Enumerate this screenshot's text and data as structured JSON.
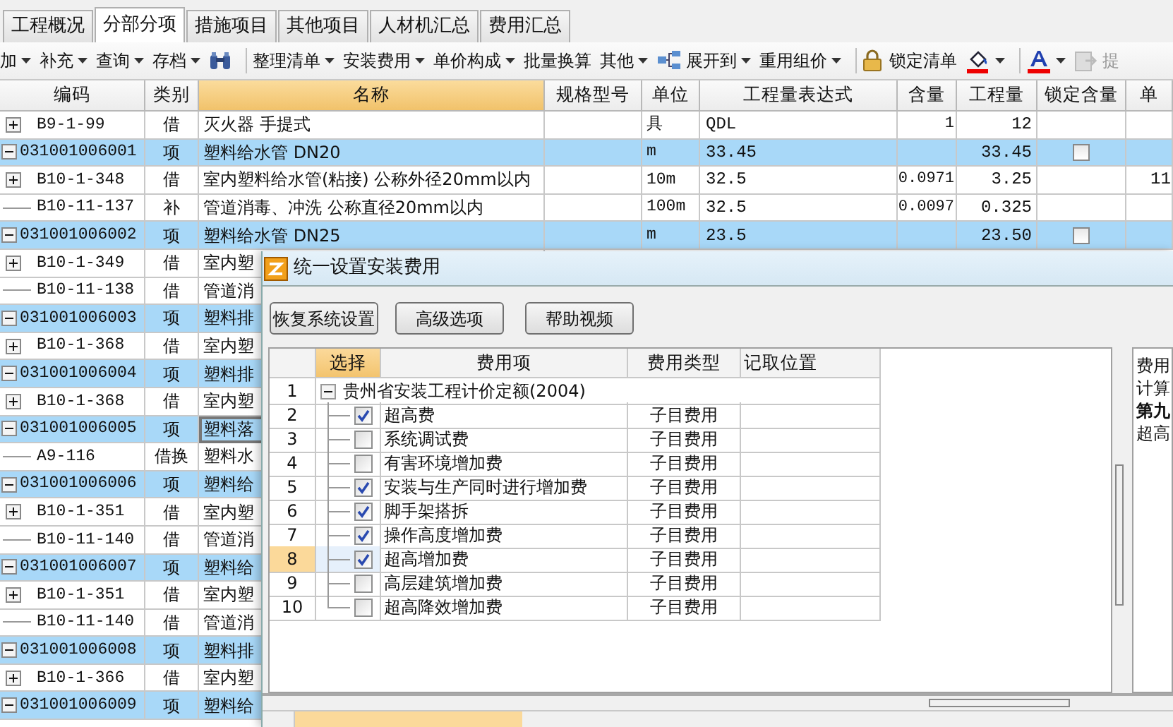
{
  "tabs": [
    {
      "label": "工程概况",
      "selected": false
    },
    {
      "label": "分部分项",
      "selected": true
    },
    {
      "label": "措施项目",
      "selected": false
    },
    {
      "label": "其他项目",
      "selected": false
    },
    {
      "label": "人材机汇总",
      "selected": false
    },
    {
      "label": "费用汇总",
      "selected": false
    }
  ],
  "toolbar": [
    {
      "kind": "menu",
      "label": "加",
      "dropdown": true
    },
    {
      "kind": "menu",
      "label": "补充",
      "dropdown": true
    },
    {
      "kind": "menu",
      "label": "查询",
      "dropdown": true
    },
    {
      "kind": "menu",
      "label": "存档",
      "dropdown": true
    },
    {
      "kind": "find"
    },
    {
      "kind": "separator"
    },
    {
      "kind": "menu",
      "label": "整理清单",
      "dropdown": true
    },
    {
      "kind": "menu",
      "label": "安装费用",
      "dropdown": true
    },
    {
      "kind": "menu",
      "label": "单价构成",
      "dropdown": true
    },
    {
      "kind": "menu",
      "label": "批量换算",
      "dropdown": false
    },
    {
      "kind": "menu",
      "label": "其他",
      "dropdown": true
    },
    {
      "kind": "expand",
      "label": "展开到",
      "dropdown": true
    },
    {
      "kind": "menu",
      "label": "重用组价",
      "dropdown": true
    },
    {
      "kind": "separator"
    },
    {
      "kind": "lock",
      "label": "锁定清单",
      "dropdown": false
    },
    {
      "kind": "fill",
      "dropdown": true
    },
    {
      "kind": "separator"
    },
    {
      "kind": "font",
      "dropdown": true
    },
    {
      "kind": "extract",
      "label": "提",
      "disabled": true
    }
  ],
  "table": {
    "columns": [
      {
        "label": "编码",
        "selected": false
      },
      {
        "label": "类别",
        "selected": false
      },
      {
        "label": "名称",
        "selected": true
      },
      {
        "label": "规格型号",
        "selected": false
      },
      {
        "label": "单位",
        "selected": false
      },
      {
        "label": "工程量表达式",
        "selected": false
      },
      {
        "label": "含量",
        "selected": false
      },
      {
        "label": "工程量",
        "selected": false
      },
      {
        "label": "锁定含量",
        "selected": false
      },
      {
        "label": "单",
        "selected": false
      }
    ],
    "rows": [
      {
        "kind": "quota",
        "expander": true,
        "expanded": false,
        "code": "B9-1-99",
        "type": "借",
        "name": "灭火器 手提式",
        "unit": "具",
        "expression": "QDL",
        "content": "1",
        "quantity": "12",
        "cell_selected": false
      },
      {
        "kind": "bill",
        "expander": true,
        "expanded": true,
        "code": "031001006001",
        "type": "项",
        "name": "塑料给水管 DN20",
        "unit": "m",
        "expression": "33.45",
        "quantity": "33.45",
        "locked": false,
        "cell_selected": false
      },
      {
        "kind": "quota",
        "expander": true,
        "expanded": false,
        "code": "B10-1-348",
        "type": "借",
        "name": "室内塑料给水管(粘接) 公称外径20mm以内",
        "unit": "10m",
        "expression": "32.5",
        "content": "0.0971",
        "quantity": "3.25",
        "price": "11",
        "cell_selected": false
      },
      {
        "kind": "quota",
        "expander": false,
        "code": "B10-11-137",
        "type": "补",
        "name": "管道消毒、冲洗 公称直径20mm以内",
        "unit": "100m",
        "expression": "32.5",
        "content": "0.0097",
        "quantity": "0.325",
        "cell_selected": false
      },
      {
        "kind": "bill",
        "expander": true,
        "expanded": true,
        "code": "031001006002",
        "type": "项",
        "name": "塑料给水管 DN25",
        "unit": "m",
        "expression": "23.5",
        "quantity": "23.50",
        "locked": false,
        "cell_selected": false
      },
      {
        "kind": "quota",
        "expander": true,
        "expanded": false,
        "code": "B10-1-349",
        "type": "借",
        "name": "室内塑",
        "cell_selected": false
      },
      {
        "kind": "quota",
        "expander": false,
        "code": "B10-11-138",
        "type": "借",
        "name": "管道消",
        "cell_selected": false
      },
      {
        "kind": "bill",
        "expander": true,
        "expanded": true,
        "code": "031001006003",
        "type": "项",
        "name": "塑料排",
        "cell_selected": false
      },
      {
        "kind": "quota",
        "expander": true,
        "expanded": false,
        "code": "B10-1-368",
        "type": "借",
        "name": "室内塑",
        "cell_selected": false
      },
      {
        "kind": "bill",
        "expander": true,
        "expanded": true,
        "code": "031001006004",
        "type": "项",
        "name": "塑料排",
        "cell_selected": false
      },
      {
        "kind": "quota",
        "expander": true,
        "expanded": false,
        "code": "B10-1-368",
        "type": "借",
        "name": "室内塑",
        "cell_selected": false
      },
      {
        "kind": "bill",
        "expander": true,
        "expanded": true,
        "code": "031001006005",
        "type": "项",
        "name": "塑料落",
        "cell_selected": true
      },
      {
        "kind": "quota",
        "expander": false,
        "code": "A9-116",
        "type": "借换",
        "name": "塑料水",
        "cell_selected": false
      },
      {
        "kind": "bill",
        "expander": true,
        "expanded": true,
        "code": "031001006006",
        "type": "项",
        "name": "塑料给",
        "cell_selected": false
      },
      {
        "kind": "quota",
        "expander": true,
        "expanded": false,
        "code": "B10-1-351",
        "type": "借",
        "name": "室内塑",
        "cell_selected": false
      },
      {
        "kind": "quota",
        "expander": false,
        "code": "B10-11-140",
        "type": "借",
        "name": "管道消",
        "cell_selected": false
      },
      {
        "kind": "bill",
        "expander": true,
        "expanded": true,
        "code": "031001006007",
        "type": "项",
        "name": "塑料给",
        "cell_selected": false
      },
      {
        "kind": "quota",
        "expander": true,
        "expanded": false,
        "code": "B10-1-351",
        "type": "借",
        "name": "室内塑",
        "cell_selected": false
      },
      {
        "kind": "quota",
        "expander": false,
        "code": "B10-11-140",
        "type": "借",
        "name": "管道消",
        "cell_selected": false
      },
      {
        "kind": "bill",
        "expander": true,
        "expanded": true,
        "code": "031001006008",
        "type": "项",
        "name": "塑料排",
        "cell_selected": false
      },
      {
        "kind": "quota",
        "expander": true,
        "expanded": false,
        "code": "B10-1-366",
        "type": "借",
        "name": "室内塑",
        "cell_selected": false
      },
      {
        "kind": "bill",
        "expander": true,
        "expanded": true,
        "code": "031001006009",
        "type": "项",
        "name": "塑料给",
        "cell_selected": false
      }
    ]
  },
  "dialog": {
    "title": "统一设置安装费用",
    "buttons": [
      "恢复系统设置",
      "高级选项",
      "帮助视频"
    ],
    "grid": {
      "columns": [
        {
          "label": "选择",
          "selected": true
        },
        {
          "label": "费用项",
          "selected": false
        },
        {
          "label": "费用类型",
          "selected": false
        },
        {
          "label": "记取位置",
          "selected": false
        }
      ],
      "root": {
        "number": "1",
        "label": "贵州省安装工程计价定额(2004)",
        "expanded": true,
        "children": [
          {
            "number": "2",
            "label": "超高费",
            "checked": true,
            "type": "子目费用",
            "selected": false
          },
          {
            "number": "3",
            "label": "系统调试费",
            "checked": false,
            "type": "子目费用",
            "selected": false
          },
          {
            "number": "4",
            "label": "有害环境增加费",
            "checked": false,
            "type": "子目费用",
            "selected": false
          },
          {
            "number": "5",
            "label": "安装与生产同时进行增加费",
            "checked": true,
            "type": "子目费用",
            "selected": false
          },
          {
            "number": "6",
            "label": "脚手架搭拆",
            "checked": true,
            "type": "子目费用",
            "selected": false
          },
          {
            "number": "7",
            "label": "操作高度增加费",
            "checked": true,
            "type": "子目费用",
            "selected": false
          },
          {
            "number": "8",
            "label": "超高增加费",
            "checked": true,
            "type": "子目费用",
            "selected": true
          },
          {
            "number": "9",
            "label": "高层建筑增加费",
            "checked": false,
            "type": "子目费用",
            "selected": false
          },
          {
            "number": "10",
            "label": "超高降效增加费",
            "checked": false,
            "type": "子目费用",
            "selected": false
          }
        ]
      }
    },
    "info_lines": [
      {
        "text": "费用",
        "bold": false
      },
      {
        "text": "计算",
        "bold": false
      },
      {
        "text": "第九",
        "bold": true
      },
      {
        "text": "超高",
        "bold": false
      }
    ]
  }
}
